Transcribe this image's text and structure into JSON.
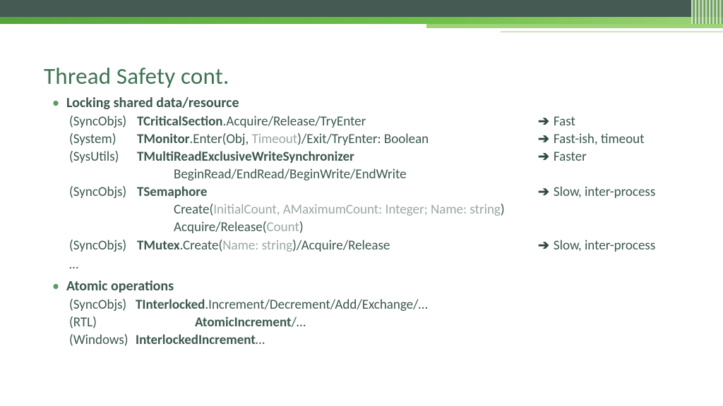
{
  "title": "Thread Safety cont.",
  "sections": {
    "locking": {
      "heading": "Locking shared data/resource",
      "rows": {
        "r1": {
          "unit": "(SyncObjs)",
          "cls": "TCriticalSection",
          "rest": ".Acquire/Release/TryEnter",
          "note": "Fast"
        },
        "r2": {
          "unit": "(System)",
          "cls": "TMonitor",
          "pre": ".Enter(Obj, ",
          "arg": "Timeout",
          "post": ")/Exit/TryEnter: Boolean",
          "note": "Fast-ish, timeout"
        },
        "r3": {
          "unit": "(SysUtils)",
          "cls": "TMultiReadExclusiveWriteSynchronizer",
          "note": "Faster"
        },
        "r3b": {
          "text": "BeginRead/EndRead/BeginWrite/EndWrite"
        },
        "r4": {
          "unit": "(SyncObjs)",
          "cls": "TSemaphore",
          "note": "Slow, inter-process"
        },
        "r4b": {
          "pre": "Create(",
          "args": "InitialCount, AMaximumCount: Integer; Name: string",
          "post": ")"
        },
        "r4c": {
          "pre": "Acquire/Release(",
          "args": "Count",
          "post": ")"
        },
        "r5": {
          "unit": "(SyncObjs)",
          "cls": "TMutex",
          "pre": ".Create(",
          "args": "Name: string",
          "post": ")/Acquire/Release",
          "note": "Slow, inter-process"
        },
        "ell": "…"
      }
    },
    "atomic": {
      "heading": "Atomic operations",
      "rows": {
        "a1": {
          "unit": "(SyncObjs)",
          "cls": "TInterlocked",
          "rest": ".Increment/Decrement/Add/Exchange/…"
        },
        "a2": {
          "unit": "(RTL)",
          "cls": "AtomicIncrement",
          "rest": "/…"
        },
        "a3": {
          "unit": "(Windows)",
          "cls": "InterlockedIncrement",
          "rest": "…"
        }
      }
    }
  }
}
